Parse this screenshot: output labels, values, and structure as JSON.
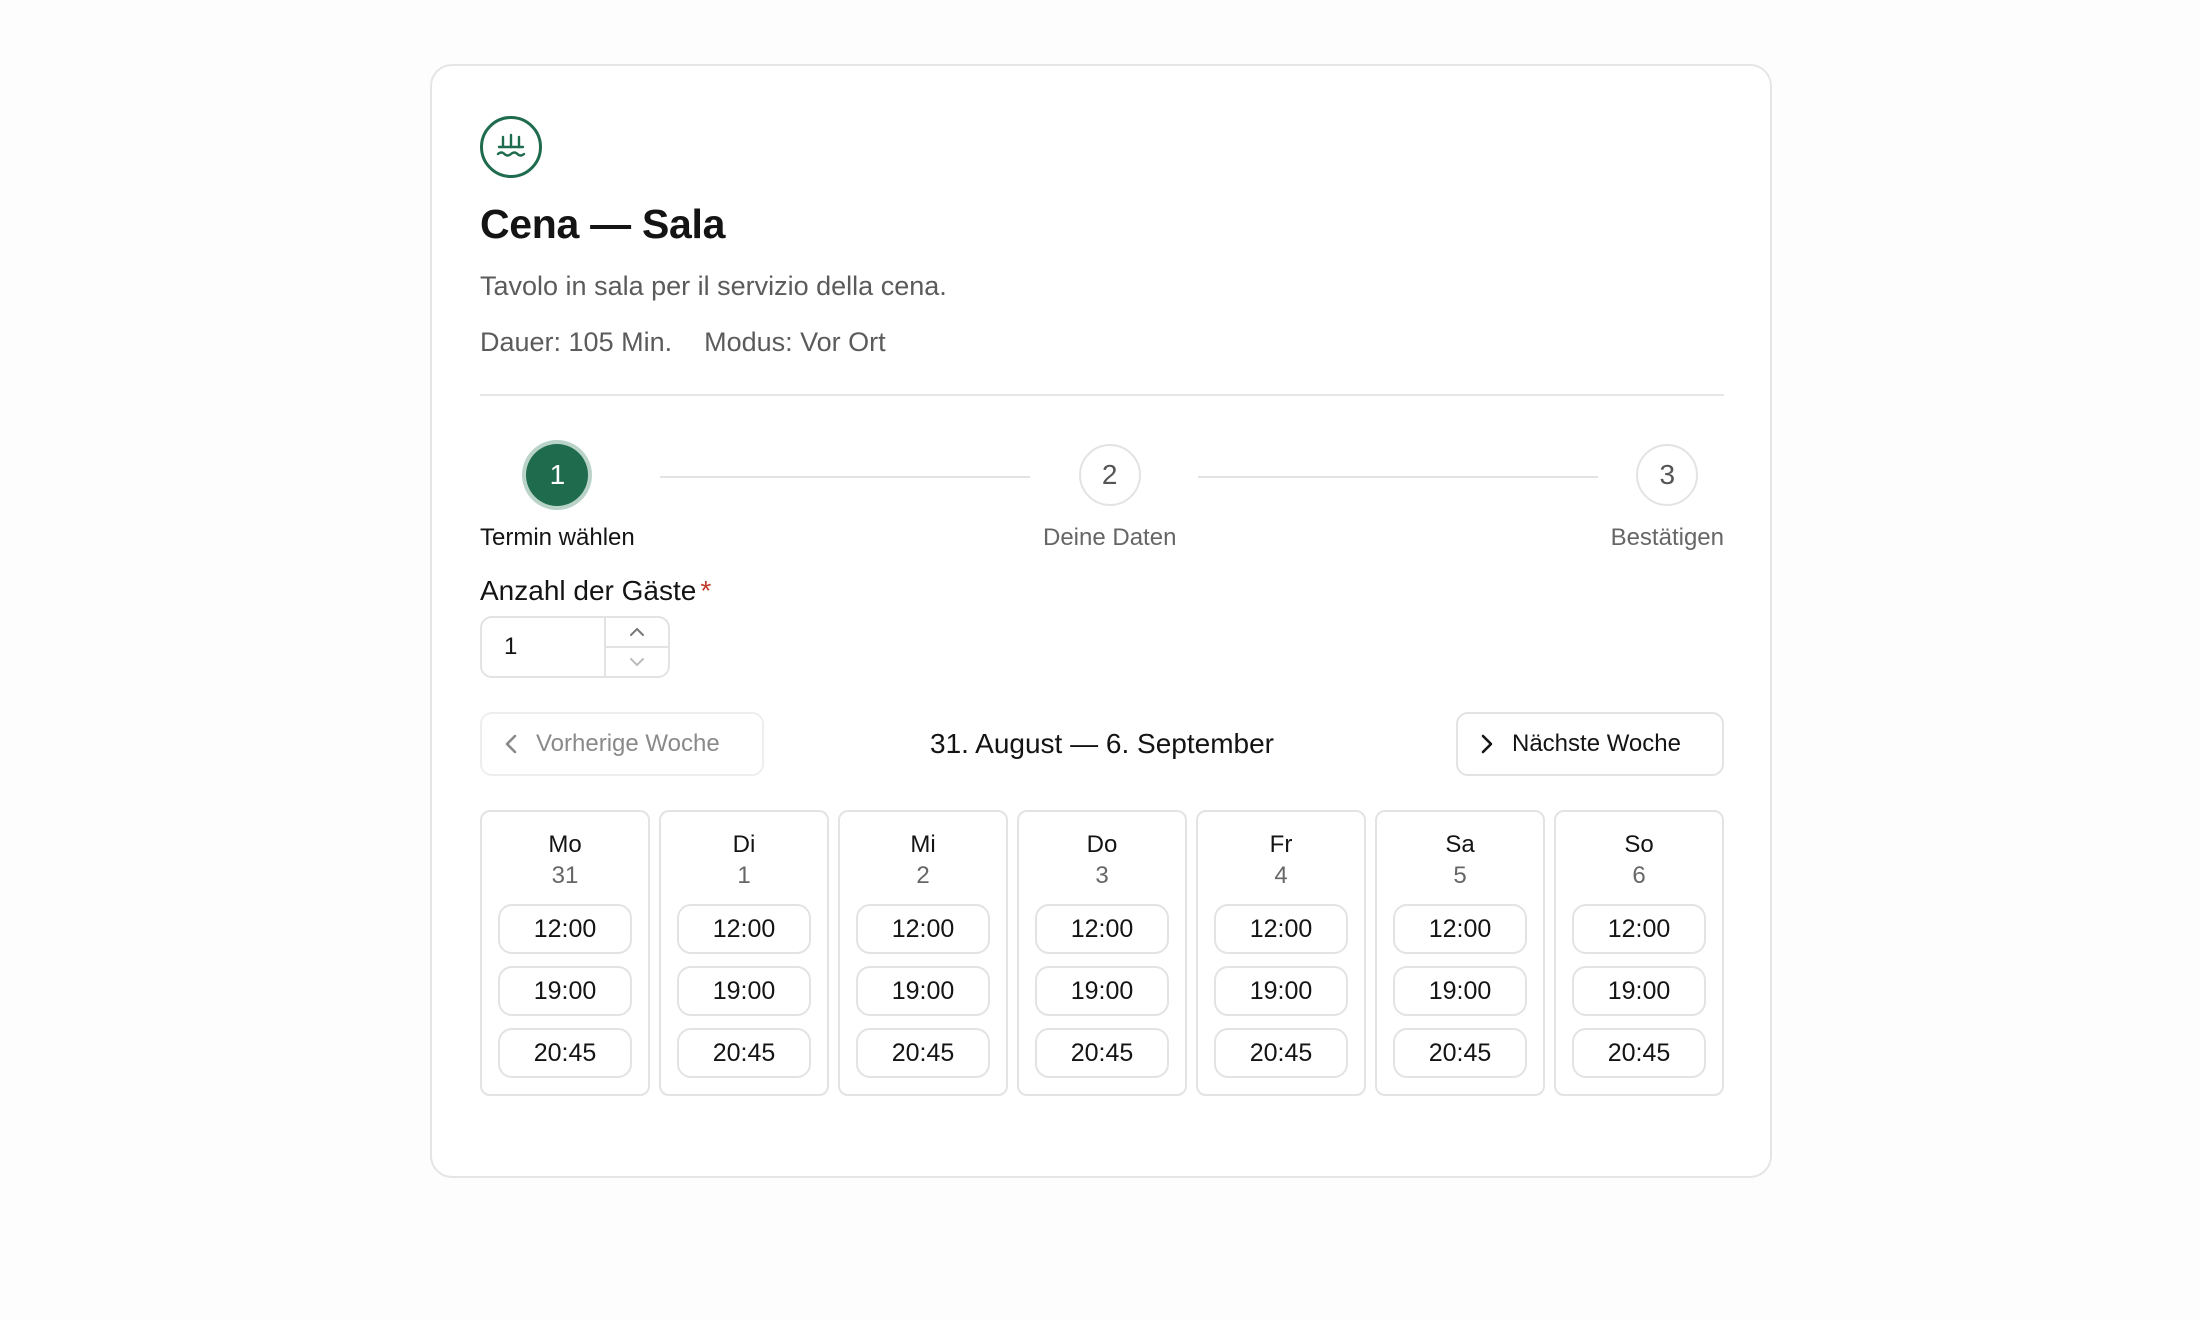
{
  "header": {
    "logo_icon": "pier-water-icon",
    "title": "Cena — Sala",
    "description": "Tavolo in sala per il servizio della cena.",
    "duration": "Dauer: 105 Min.",
    "mode": "Modus: Vor Ort"
  },
  "colors": {
    "accent": "#1f6b4e",
    "required": "#c0392b"
  },
  "steps": [
    {
      "number": "1",
      "label": "Termin wählen",
      "active": true
    },
    {
      "number": "2",
      "label": "Deine Daten",
      "active": false
    },
    {
      "number": "3",
      "label": "Bestätigen",
      "active": false
    }
  ],
  "guests": {
    "label": "Anzahl der Gäste",
    "required_mark": "*",
    "value": "1"
  },
  "week_nav": {
    "prev_label": "Vorherige Woche",
    "next_label": "Nächste Woche",
    "range": "31. August — 6. September"
  },
  "days": [
    {
      "name": "Mo",
      "date": "31",
      "slots": [
        "12:00",
        "19:00",
        "20:45"
      ]
    },
    {
      "name": "Di",
      "date": "1",
      "slots": [
        "12:00",
        "19:00",
        "20:45"
      ]
    },
    {
      "name": "Mi",
      "date": "2",
      "slots": [
        "12:00",
        "19:00",
        "20:45"
      ]
    },
    {
      "name": "Do",
      "date": "3",
      "slots": [
        "12:00",
        "19:00",
        "20:45"
      ]
    },
    {
      "name": "Fr",
      "date": "4",
      "slots": [
        "12:00",
        "19:00",
        "20:45"
      ]
    },
    {
      "name": "Sa",
      "date": "5",
      "slots": [
        "12:00",
        "19:00",
        "20:45"
      ]
    },
    {
      "name": "So",
      "date": "6",
      "slots": [
        "12:00",
        "19:00",
        "20:45"
      ]
    }
  ]
}
